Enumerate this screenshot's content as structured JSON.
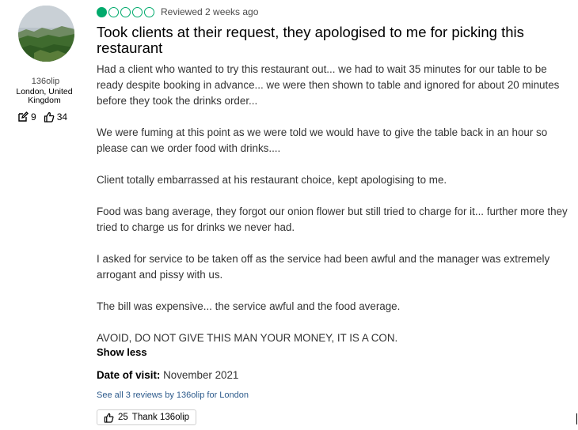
{
  "user": {
    "name": "136olip",
    "location": "London, United Kingdom",
    "contributions": "9",
    "helpful_votes": "34"
  },
  "review": {
    "rating": 1,
    "rating_max": 5,
    "accent_color": "#00aa6c",
    "reviewed": "Reviewed 2 weeks ago",
    "title": "Took clients at their request, they apologised to me for picking this restaurant",
    "paragraphs": [
      "Had a client who wanted to try this restaurant out... we had to wait 35 minutes for our table to be ready despite booking in advance... we were then shown to table and ignored for about 20 minutes before they took the drinks order...",
      "We were fuming at this point as we were told we would have to give the table back in an hour so please can we order food with drinks....",
      "Client totally embarrassed at his restaurant choice, kept apologising to me.",
      "Food was bang average, they forgot our onion flower but still tried to charge for it... further more they tried to charge us for drinks we never had.",
      "I asked for service to be taken off as the service had been awful and the manager was extremely arrogant and pissy with us.",
      "The bill was expensive... the service awful and the food average.",
      "AVOID, DO NOT GIVE THIS MAN YOUR MONEY, IT IS A CON."
    ],
    "show_less": "Show less",
    "date_label": "Date of visit:",
    "date_value": "November 2021",
    "see_all": "See all 3 reviews by 136olip for London",
    "thank_count": "25",
    "thank_label": "Thank 136olip"
  }
}
